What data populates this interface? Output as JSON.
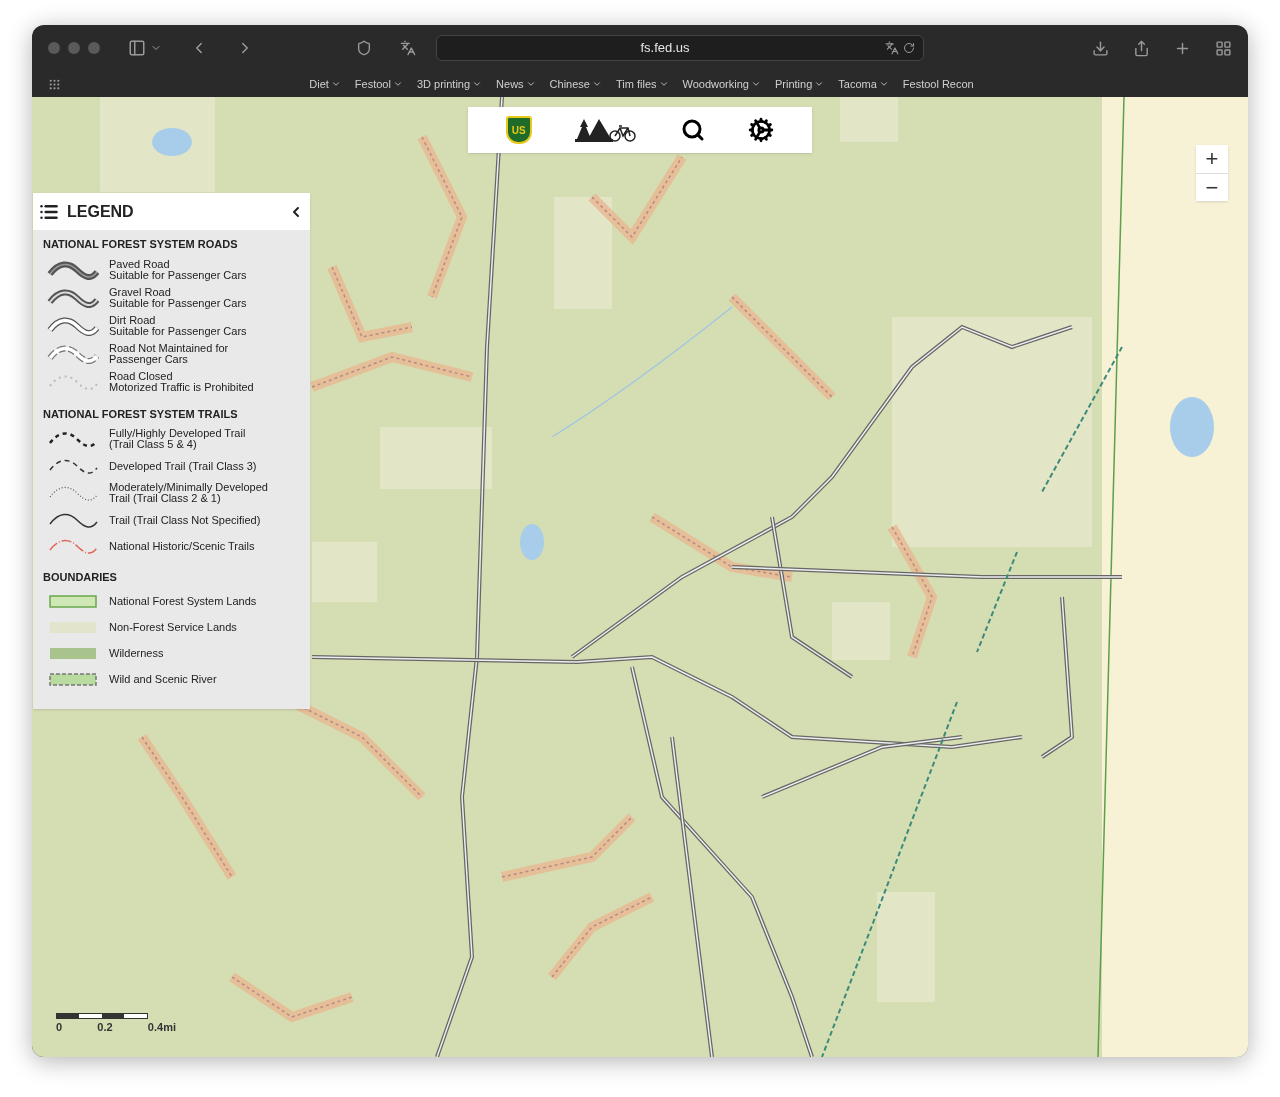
{
  "browser": {
    "address": "fs.fed.us",
    "bookmarks": [
      {
        "label": "Diet",
        "menu": true
      },
      {
        "label": "Festool",
        "menu": true
      },
      {
        "label": "3D printing",
        "menu": true
      },
      {
        "label": "News",
        "menu": true
      },
      {
        "label": "Chinese",
        "menu": true
      },
      {
        "label": "Tim files",
        "menu": true
      },
      {
        "label": "Woodworking",
        "menu": true
      },
      {
        "label": "Printing",
        "menu": true
      },
      {
        "label": "Tacoma",
        "menu": true
      },
      {
        "label": "Festool Recon",
        "menu": false
      }
    ]
  },
  "toolbar": {
    "logo_text": "US"
  },
  "zoom": {
    "in": "+",
    "out": "−"
  },
  "legend": {
    "title": "LEGEND",
    "sections": [
      {
        "heading": "NATIONAL FOREST SYSTEM ROADS",
        "items": [
          {
            "kind": "paved",
            "lines": [
              "Paved Road",
              "Suitable for Passenger Cars"
            ]
          },
          {
            "kind": "gravel",
            "lines": [
              "Gravel Road",
              "Suitable for Passenger Cars"
            ]
          },
          {
            "kind": "dirt",
            "lines": [
              "Dirt Road",
              "Suitable for Passenger Cars"
            ]
          },
          {
            "kind": "unmaintained",
            "lines": [
              "Road Not Maintained for",
              "Passenger Cars"
            ]
          },
          {
            "kind": "closed",
            "lines": [
              "Road Closed",
              "Motorized Traffic is Prohibited"
            ]
          }
        ]
      },
      {
        "heading": "NATIONAL FOREST SYSTEM TRAILS",
        "items": [
          {
            "kind": "trail_full",
            "lines": [
              "Fully/Highly Developed Trail",
              "(Trail Class 5 & 4)"
            ]
          },
          {
            "kind": "trail_dev",
            "lines": [
              "Developed Trail (Trail Class 3)"
            ]
          },
          {
            "kind": "trail_min",
            "lines": [
              "Moderately/Minimally Developed",
              "Trail (Trail Class 2 & 1)"
            ]
          },
          {
            "kind": "trail",
            "lines": [
              "Trail (Trail Class Not Specified)"
            ]
          },
          {
            "kind": "historic",
            "lines": [
              "National Historic/Scenic Trails"
            ]
          }
        ]
      },
      {
        "heading": "BOUNDARIES",
        "items": [
          {
            "kind": "forest_land",
            "lines": [
              "National Forest System Lands"
            ]
          },
          {
            "kind": "non_forest",
            "lines": [
              "Non-Forest Service Lands"
            ]
          },
          {
            "kind": "wilderness",
            "lines": [
              "Wilderness"
            ]
          },
          {
            "kind": "river",
            "lines": [
              "Wild and Scenic River"
            ]
          }
        ]
      }
    ]
  },
  "scale_bar": {
    "labels": [
      "0",
      "0.2",
      "0.4mi"
    ]
  }
}
